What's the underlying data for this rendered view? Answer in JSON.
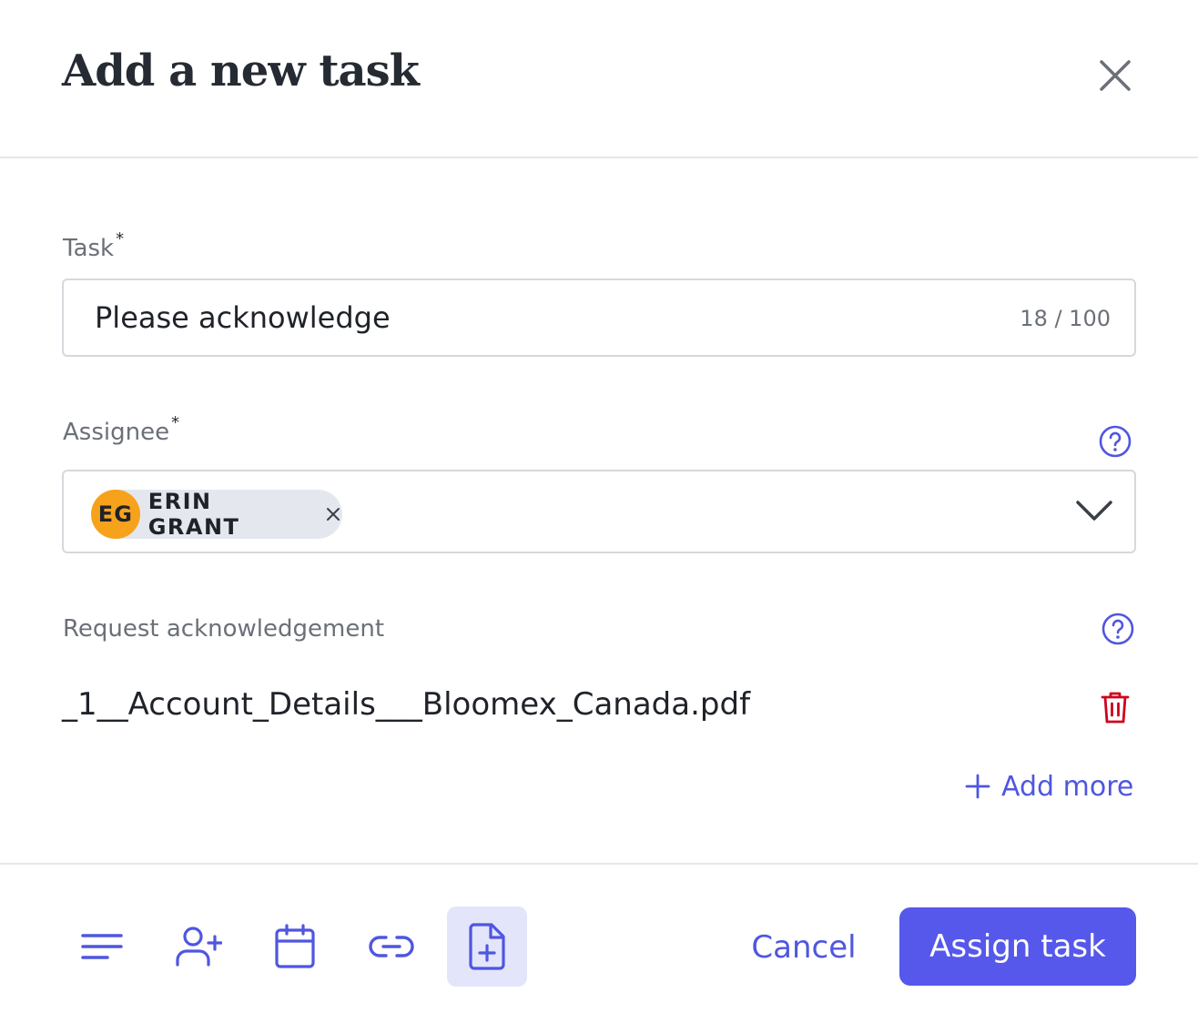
{
  "dialog": {
    "title": "Add a new task"
  },
  "task": {
    "label": "Task",
    "required_mark": "*",
    "value": "Please acknowledge",
    "counter": "18 / 100"
  },
  "assignee": {
    "label": "Assignee",
    "required_mark": "*",
    "chip": {
      "initials": "EG",
      "name": "ERIN GRANT",
      "avatar_color": "#f7a21b"
    }
  },
  "acknowledgement": {
    "label": "Request acknowledgement",
    "file_name": "_1__Account_Details___Bloomex_Canada.pdf",
    "add_more_label": "Add more"
  },
  "footer": {
    "cancel_label": "Cancel",
    "assign_label": "Assign task",
    "tools": [
      "description-icon",
      "add-person-icon",
      "calendar-icon",
      "link-icon",
      "file-add-icon"
    ]
  },
  "colors": {
    "accent": "#5558ea",
    "link": "#4f56e0",
    "danger": "#d0021b",
    "active_tool_bg": "#e3e5fb"
  }
}
